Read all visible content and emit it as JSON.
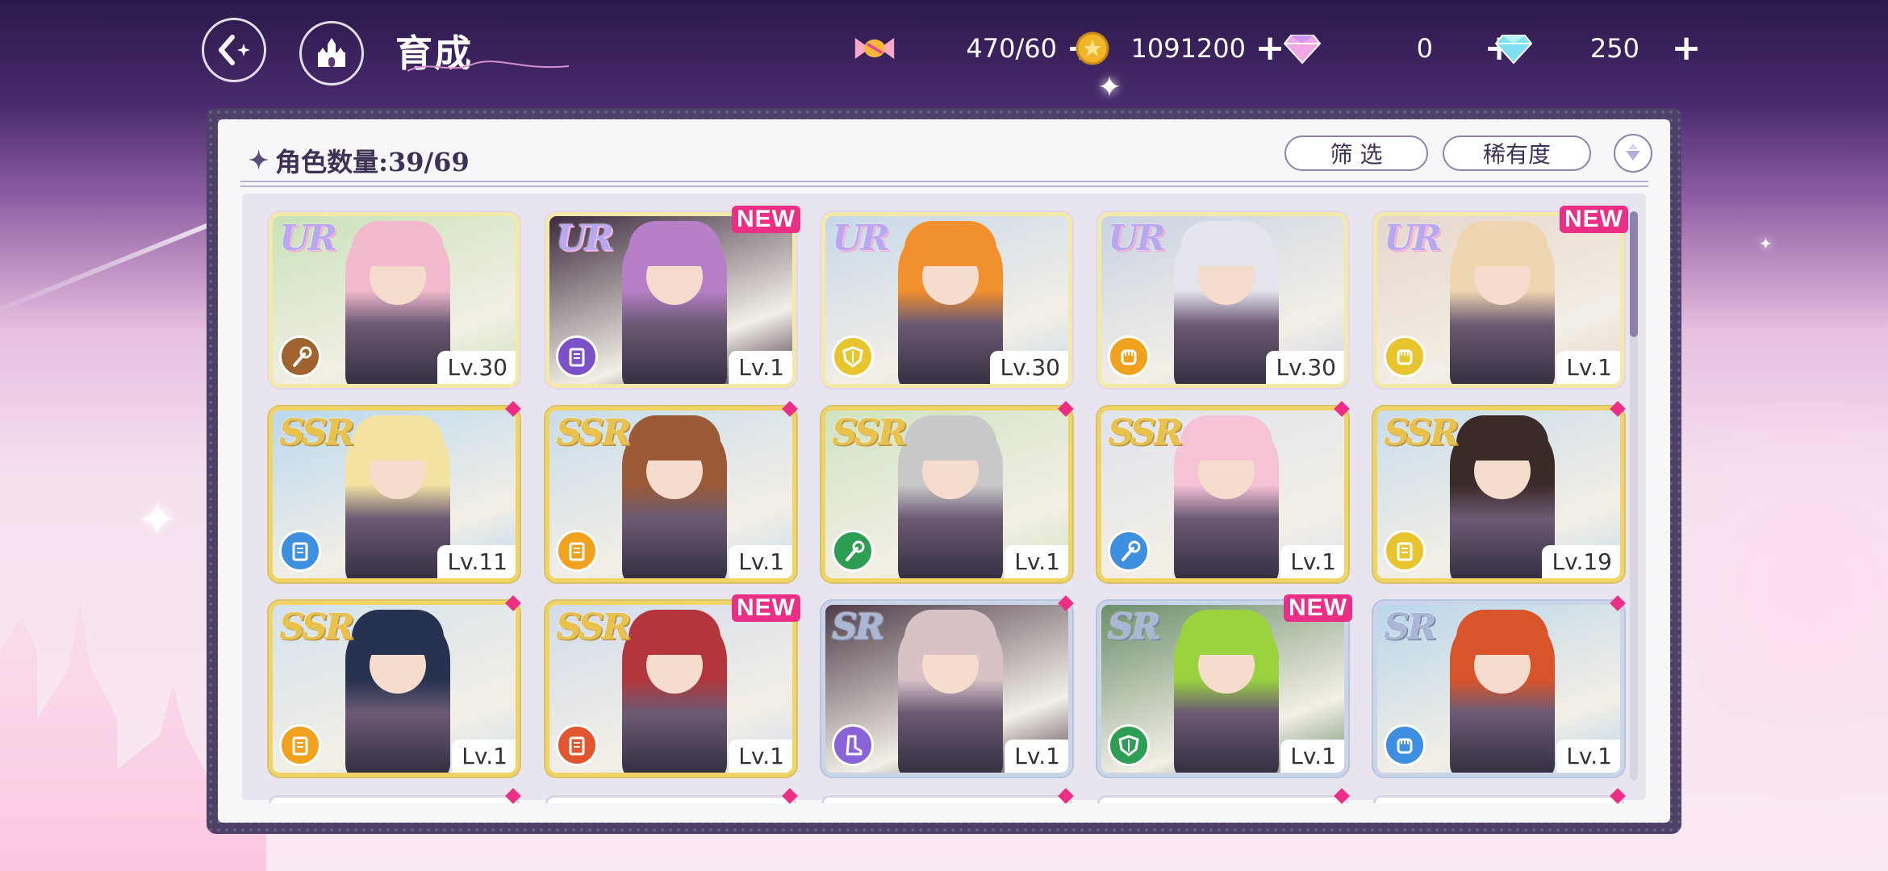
{
  "header": {
    "title": "育成",
    "back_icon": "back-arrow-icon",
    "home_icon": "castle-icon"
  },
  "currencies": [
    {
      "name": "stamina",
      "icon": "candy-icon",
      "value": "470/60"
    },
    {
      "name": "coins",
      "icon": "coin-icon",
      "value": "1091200"
    },
    {
      "name": "paid-gems",
      "icon": "pink-diamond-icon",
      "value": "0"
    },
    {
      "name": "free-gems",
      "icon": "blue-diamond-icon",
      "value": "250"
    }
  ],
  "panel": {
    "count_label": "角色数量:39/69",
    "filter_label": "筛 选",
    "sort_label": "稀有度"
  },
  "cards": [
    {
      "rarity": "UR",
      "level": "Lv.30",
      "new": false,
      "class_color": "#a0622e",
      "class_icon": "scepter-icon",
      "hair": "#f1b9cb",
      "bg": "#c8e2b8"
    },
    {
      "rarity": "UR",
      "level": "Lv.1",
      "new": true,
      "class_color": "#7c50c6",
      "class_icon": "book-icon",
      "hair": "#b77fc7",
      "bg": "#3b2a3e"
    },
    {
      "rarity": "UR",
      "level": "Lv.30",
      "new": false,
      "class_color": "#e8c52e",
      "class_icon": "shield-icon",
      "hair": "#f3902e",
      "bg": "#c7d8ea"
    },
    {
      "rarity": "UR",
      "level": "Lv.30",
      "new": false,
      "class_color": "#f0a21e",
      "class_icon": "fist-icon",
      "hair": "#e5e5ee",
      "bg": "#c9d3e4"
    },
    {
      "rarity": "UR",
      "level": "Lv.1",
      "new": true,
      "class_color": "#e8c52e",
      "class_icon": "fist-icon",
      "hair": "#f0d6b0",
      "bg": "#e6d6ce"
    },
    {
      "rarity": "SSR",
      "level": "Lv.11",
      "new": false,
      "class_color": "#3d8fe0",
      "class_icon": "book-icon",
      "hair": "#f3e2a2",
      "bg": "#b9d8ef"
    },
    {
      "rarity": "SSR",
      "level": "Lv.1",
      "new": false,
      "class_color": "#f0a21e",
      "class_icon": "book-icon",
      "hair": "#9a5a36",
      "bg": "#c8dcec"
    },
    {
      "rarity": "SSR",
      "level": "Lv.1",
      "new": false,
      "class_color": "#2f9e55",
      "class_icon": "scepter-icon",
      "hair": "#c9c9c9",
      "bg": "#cfe3c2"
    },
    {
      "rarity": "SSR",
      "level": "Lv.1",
      "new": false,
      "class_color": "#3d8fe0",
      "class_icon": "scepter-icon",
      "hair": "#f6c2d6",
      "bg": "#dfe3ee"
    },
    {
      "rarity": "SSR",
      "level": "Lv.19",
      "new": false,
      "class_color": "#e8c52e",
      "class_icon": "book-icon",
      "hair": "#3b2b28",
      "bg": "#c8dcec"
    },
    {
      "rarity": "SSR",
      "level": "Lv.1",
      "new": false,
      "class_color": "#f0a21e",
      "class_icon": "book-icon",
      "hair": "#26324f",
      "bg": "#d3e2ee"
    },
    {
      "rarity": "SSR",
      "level": "Lv.1",
      "new": true,
      "class_color": "#e0562e",
      "class_icon": "book-icon",
      "hair": "#b2363b",
      "bg": "#d1dcec"
    },
    {
      "rarity": "SR",
      "level": "Lv.1",
      "new": false,
      "class_color": "#8a63d8",
      "class_icon": "boot-icon",
      "hair": "#d8c2c6",
      "bg": "#4d3c4a"
    },
    {
      "rarity": "SR",
      "level": "Lv.1",
      "new": true,
      "class_color": "#2f9e55",
      "class_icon": "shield-icon",
      "hair": "#9bd33e",
      "bg": "#6b8e6a"
    },
    {
      "rarity": "SR",
      "level": "Lv.1",
      "new": false,
      "class_color": "#3d8fe0",
      "class_icon": "fist-icon",
      "hair": "#d9542a",
      "bg": "#b9d6ea"
    }
  ]
}
